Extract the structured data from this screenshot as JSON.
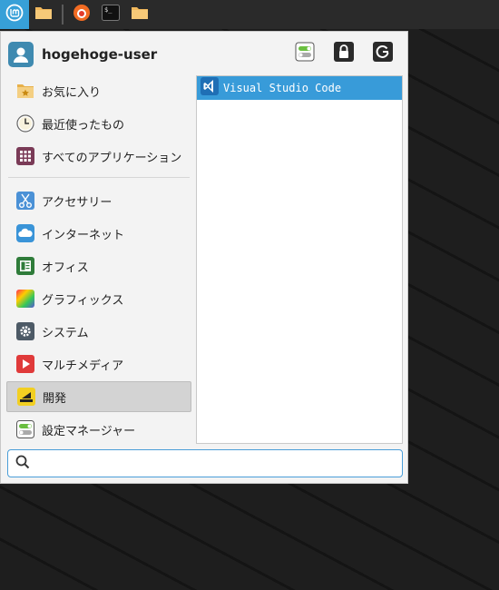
{
  "taskbar": {
    "items": [
      {
        "name": "whisker-menu-icon",
        "color": "#37a0d8"
      },
      {
        "name": "folder-icon",
        "color": "#f0b860"
      },
      {
        "name": "firefox-icon",
        "color": "#e0492a"
      },
      {
        "name": "terminal-icon",
        "color": "#1e1e1e"
      },
      {
        "name": "folder-icon",
        "color": "#f0b860"
      }
    ]
  },
  "user": {
    "name": "hogehoge-user"
  },
  "header_actions": [
    {
      "name": "settings-manager-icon"
    },
    {
      "name": "lock-screen-icon"
    },
    {
      "name": "logout-icon"
    }
  ],
  "categories": [
    {
      "label": "お気に入り",
      "icon": "favorites-icon"
    },
    {
      "label": "最近使ったもの",
      "icon": "recent-clock-icon"
    },
    {
      "label": "すべてのアプリケーション",
      "icon": "all-apps-grid-icon"
    },
    {
      "label": "アクセサリー",
      "icon": "accessories-scissors-icon"
    },
    {
      "label": "インターネット",
      "icon": "internet-cloud-icon"
    },
    {
      "label": "オフィス",
      "icon": "office-icon"
    },
    {
      "label": "グラフィックス",
      "icon": "graphics-icon"
    },
    {
      "label": "システム",
      "icon": "system-gear-icon"
    },
    {
      "label": "マルチメディア",
      "icon": "multimedia-play-icon"
    },
    {
      "label": "開発",
      "icon": "development-icon",
      "selected": true
    },
    {
      "label": "設定マネージャー",
      "icon": "settings-manager-icon"
    }
  ],
  "apps": [
    {
      "label": "Visual Studio Code",
      "icon": "vscode-icon",
      "selected": true
    }
  ],
  "search": {
    "value": "",
    "placeholder": ""
  },
  "colors": {
    "accent": "#389bd9",
    "panel": "#f3f3f3",
    "taskbar": "#2a2a2a"
  }
}
